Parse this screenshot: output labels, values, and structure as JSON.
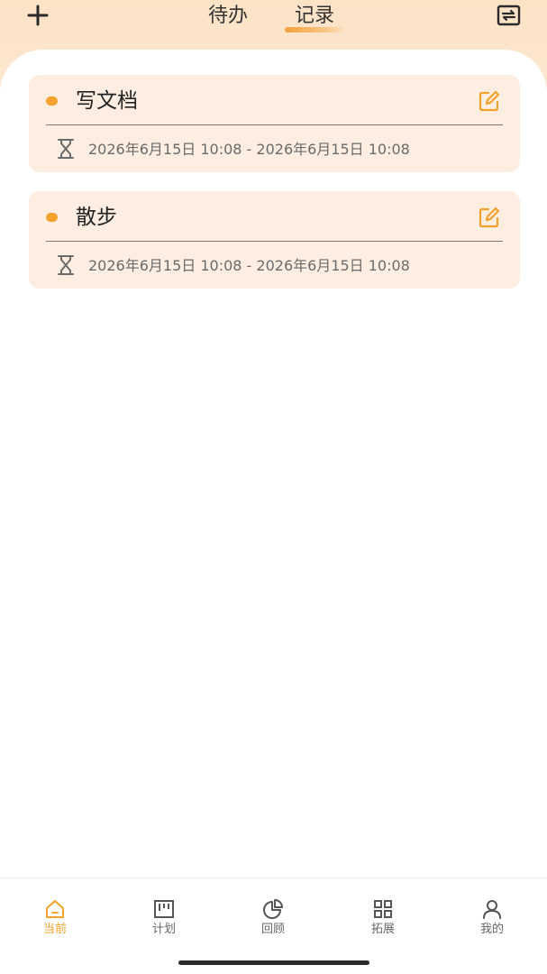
{
  "header": {
    "add_icon": "plus-icon",
    "tabs": [
      {
        "label": "待办",
        "active": false
      },
      {
        "label": "记录",
        "active": true
      }
    ],
    "sync_icon": "sync-icon"
  },
  "records": [
    {
      "title": "写文档",
      "time_range": "2026年6月15日 10:08 - 2026年6月15日 10:08"
    },
    {
      "title": "散步",
      "time_range": "2026年6月15日 10:08 - 2026年6月15日 10:08"
    }
  ],
  "tabbar": {
    "items": [
      {
        "label": "当前",
        "icon": "home-icon",
        "active": true
      },
      {
        "label": "计划",
        "icon": "kanban-icon",
        "active": false
      },
      {
        "label": "回顾",
        "icon": "pie-chart-icon",
        "active": false
      },
      {
        "label": "拓展",
        "icon": "grid-icon",
        "active": false
      },
      {
        "label": "我的",
        "icon": "user-icon",
        "active": false
      }
    ]
  },
  "colors": {
    "accent": "#f4a22e",
    "card_bg": "#fdeee1",
    "header_bg": "#fde3c6"
  }
}
